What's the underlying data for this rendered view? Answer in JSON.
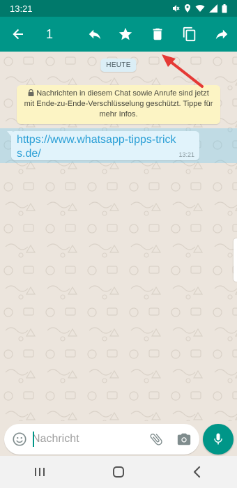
{
  "status_bar": {
    "time": "13:21",
    "icons": [
      "mute-icon",
      "location-icon",
      "wifi-icon",
      "signal-icon",
      "battery-icon"
    ]
  },
  "action_bar": {
    "selected_count": "1",
    "icons": [
      "back-arrow-icon",
      "reply-icon",
      "star-icon",
      "delete-icon",
      "copy-icon",
      "forward-icon"
    ]
  },
  "chat": {
    "date_label": "HEUTE",
    "encryption_notice": "Nachrichten in diesem Chat sowie Anrufe sind jetzt mit Ende-zu-Ende-Verschlüsselung geschützt. Tippe für mehr Infos.",
    "message": {
      "text": "https://www.whatsapp-tipps-tricks.de/",
      "time": "13:21"
    }
  },
  "composer": {
    "placeholder": "Nachricht"
  },
  "nav_bar": {
    "icons": [
      "recents-icon",
      "home-icon",
      "back-icon"
    ]
  },
  "colors": {
    "primary": "#009688",
    "status_bar": "#00796b",
    "chat_bg": "#ece5dd",
    "link": "#2a9fd6",
    "annotation_arrow": "#e53935"
  }
}
